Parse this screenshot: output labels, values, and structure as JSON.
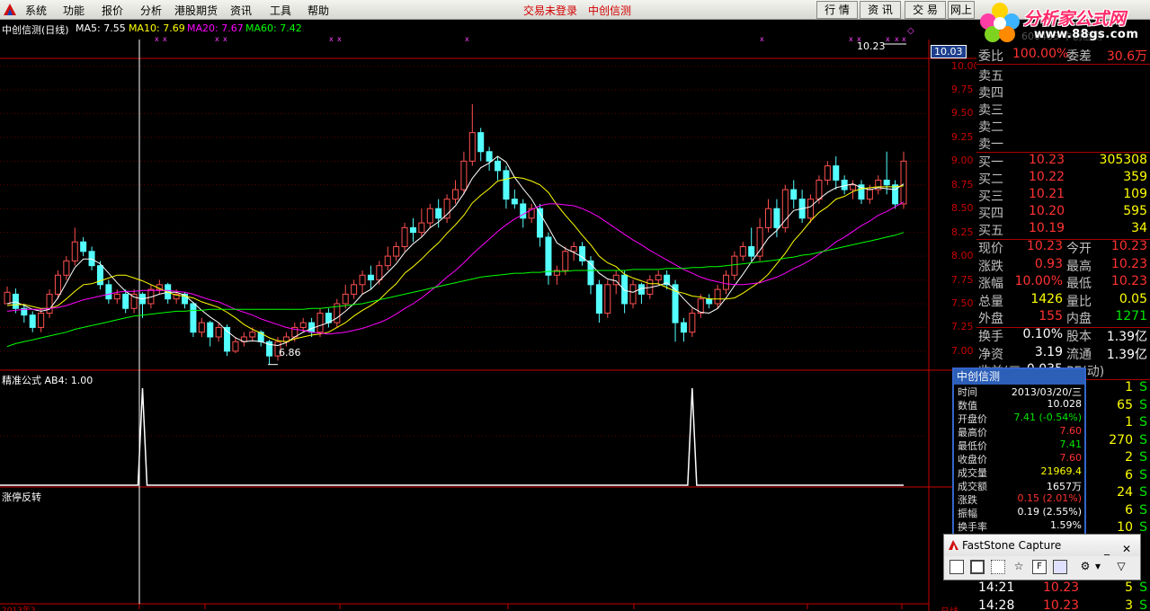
{
  "menu": {
    "items": [
      "系统",
      "功能",
      "报价",
      "分析",
      "港股期货",
      "资讯",
      "工具",
      "帮助"
    ],
    "status_text": "交易未登录",
    "stock_label": "中创信测",
    "right_tabs": [
      "行 情",
      "资 讯",
      "交 易",
      "网上"
    ]
  },
  "watermark": {
    "title": "分析家公式网",
    "url": "www.88gs.com",
    "ghost_text": "600485 中创信测"
  },
  "main_pane": {
    "title": "中创信测(日线)",
    "ma_labels": [
      {
        "text": "MA5: 7.55",
        "color": "#ffffff"
      },
      {
        "text": "MA10: 7.69",
        "color": "#ffff00"
      },
      {
        "text": "MA20: 7.67",
        "color": "#ff00ff"
      },
      {
        "text": "MA60: 7.42",
        "color": "#00ff00"
      }
    ],
    "price_axis": [
      "10.00",
      "9.75",
      "9.50",
      "9.25",
      "9.00",
      "8.75",
      "8.50",
      "8.25",
      "8.00",
      "7.75",
      "7.50",
      "7.25",
      "7.00"
    ],
    "current_price_tag": "10.03",
    "high_marker": "10.23",
    "low_marker": "6.86"
  },
  "indicator_pane": {
    "title": "精准公式 AB4: 1.00"
  },
  "bottom_pane": {
    "title": "涨停反转"
  },
  "bottom_axis": {
    "partial_date": "2013年3",
    "partial_right": "日线"
  },
  "panel": {
    "weibi": {
      "l1": "委比",
      "v1": "100.00%",
      "l2": "委差",
      "v2": "30.6万"
    },
    "sell": [
      "卖五",
      "卖四",
      "卖三",
      "卖二",
      "卖一"
    ],
    "buy": [
      {
        "label": "买一",
        "price": "10.23",
        "vol": "305308"
      },
      {
        "label": "买二",
        "price": "10.22",
        "vol": "359"
      },
      {
        "label": "买三",
        "price": "10.21",
        "vol": "109"
      },
      {
        "label": "买四",
        "price": "10.20",
        "vol": "595"
      },
      {
        "label": "买五",
        "price": "10.19",
        "vol": "34"
      }
    ],
    "stats": [
      {
        "l1": "现价",
        "v1": "10.23",
        "c1": "red",
        "l2": "今开",
        "v2": "10.23",
        "c2": "red"
      },
      {
        "l1": "涨跌",
        "v1": "0.93",
        "c1": "red",
        "l2": "最高",
        "v2": "10.23",
        "c2": "red"
      },
      {
        "l1": "涨幅",
        "v1": "10.00%",
        "c1": "red",
        "l2": "最低",
        "v2": "10.23",
        "c2": "red"
      },
      {
        "l1": "总量",
        "v1": "1426",
        "c1": "yel",
        "l2": "量比",
        "v2": "0.05",
        "c2": "yel"
      },
      {
        "l1": "外盘",
        "v1": "155",
        "c1": "red",
        "l2": "内盘",
        "v2": "1271",
        "c2": "green"
      }
    ],
    "stats2": [
      {
        "l1": "换手",
        "v1": "0.10%",
        "l2": "股本",
        "v2": "1.39亿"
      },
      {
        "l1": "净资",
        "v1": "3.19",
        "l2": "流通",
        "v2": "1.39亿"
      },
      {
        "l1": "收益(三",
        "v1": "0.035",
        "l2": "PE(动)",
        "v2": ""
      }
    ],
    "ticks": [
      {
        "vol": "1",
        "side": "S"
      },
      {
        "vol": "65",
        "side": "S"
      },
      {
        "vol": "1",
        "side": "S"
      },
      {
        "vol": "270",
        "side": "S"
      },
      {
        "vol": "2",
        "side": "S"
      },
      {
        "vol": "6",
        "side": "S"
      },
      {
        "vol": "24",
        "side": "S"
      },
      {
        "vol": "6",
        "side": "S"
      },
      {
        "vol": "10",
        "side": "S"
      }
    ],
    "bottom_ticks": [
      {
        "time": "14:21",
        "price": "10.23",
        "vol": "5",
        "side": "S"
      },
      {
        "time": "14:28",
        "price": "10.23",
        "vol": "3",
        "side": "S"
      }
    ]
  },
  "popup": {
    "title": "中创信测",
    "rows": [
      {
        "k": "时间",
        "v": "2013/03/20/三",
        "c": "#ffffff"
      },
      {
        "k": "数值",
        "v": "10.028",
        "c": "#ffffff"
      },
      {
        "k": "开盘价",
        "v": "7.41 (-0.54%)",
        "c": "#00e600"
      },
      {
        "k": "最高价",
        "v": "7.60",
        "c": "#ff3232"
      },
      {
        "k": "最低价",
        "v": "7.41",
        "c": "#00e600"
      },
      {
        "k": "收盘价",
        "v": "7.60",
        "c": "#ff3232"
      },
      {
        "k": "成交量",
        "v": "21969.4",
        "c": "#ffff00"
      },
      {
        "k": "成交额",
        "v": "1657万",
        "c": "#ffffff"
      },
      {
        "k": "涨跌",
        "v": "0.15 (2.01%)",
        "c": "#ff3232"
      },
      {
        "k": "振幅",
        "v": "0.19 (2.55%)",
        "c": "#ffffff"
      },
      {
        "k": "换手率",
        "v": "1.59%",
        "c": "#ffffff"
      }
    ]
  },
  "faststone": {
    "title": "FastStone Capture",
    "min_label": "_",
    "close_label": "✕"
  },
  "chart_data": {
    "type": "candlestick",
    "title": "中创信测(日线)",
    "ylim": [
      6.8,
      10.1
    ],
    "candles": [
      [
        7.5,
        7.62,
        7.55,
        7.68
      ],
      [
        7.6,
        7.45,
        7.4,
        7.66
      ],
      [
        7.45,
        7.38,
        7.3,
        7.5
      ],
      [
        7.38,
        7.25,
        7.2,
        7.42
      ],
      [
        7.25,
        7.4,
        7.2,
        7.45
      ],
      [
        7.4,
        7.6,
        7.35,
        7.65
      ],
      [
        7.6,
        7.8,
        7.55,
        7.85
      ],
      [
        7.8,
        7.95,
        7.75,
        8.0
      ],
      [
        7.95,
        8.15,
        7.9,
        8.3
      ],
      [
        8.15,
        8.05,
        8.0,
        8.2
      ],
      [
        8.05,
        7.9,
        7.85,
        8.1
      ],
      [
        7.9,
        7.7,
        7.65,
        7.95
      ],
      [
        7.7,
        7.55,
        7.5,
        7.75
      ],
      [
        7.55,
        7.6,
        7.5,
        7.65
      ],
      [
        7.6,
        7.45,
        7.4,
        7.65
      ],
      [
        7.45,
        7.6,
        7.4,
        7.65
      ],
      [
        7.6,
        7.5,
        7.35,
        7.62
      ],
      [
        7.5,
        7.65,
        7.45,
        7.7
      ],
      [
        7.65,
        7.7,
        7.6,
        7.75
      ],
      [
        7.7,
        7.55,
        7.5,
        7.72
      ],
      [
        7.55,
        7.6,
        7.5,
        7.65
      ],
      [
        7.6,
        7.5,
        7.45,
        7.62
      ],
      [
        7.5,
        7.2,
        7.15,
        7.52
      ],
      [
        7.2,
        7.3,
        7.15,
        7.35
      ],
      [
        7.3,
        7.15,
        7.05,
        7.32
      ],
      [
        7.15,
        7.25,
        7.1,
        7.3
      ],
      [
        7.25,
        7.0,
        6.95,
        7.28
      ],
      [
        7.0,
        7.1,
        6.98,
        7.15
      ],
      [
        7.1,
        7.15,
        7.05,
        7.2
      ],
      [
        7.15,
        7.2,
        7.1,
        7.25
      ],
      [
        7.2,
        7.1,
        7.05,
        7.22
      ],
      [
        7.1,
        6.95,
        6.86,
        7.12
      ],
      [
        6.95,
        7.1,
        6.9,
        7.15
      ],
      [
        7.1,
        7.15,
        7.05,
        7.2
      ],
      [
        7.15,
        7.25,
        7.1,
        7.3
      ],
      [
        7.25,
        7.3,
        7.2,
        7.35
      ],
      [
        7.3,
        7.2,
        7.15,
        7.35
      ],
      [
        7.2,
        7.4,
        7.15,
        7.45
      ],
      [
        7.4,
        7.3,
        7.25,
        7.45
      ],
      [
        7.3,
        7.5,
        7.25,
        7.55
      ],
      [
        7.5,
        7.6,
        7.45,
        7.7
      ],
      [
        7.6,
        7.7,
        7.55,
        7.75
      ],
      [
        7.7,
        7.8,
        7.6,
        7.85
      ],
      [
        7.8,
        7.75,
        7.65,
        7.9
      ],
      [
        7.75,
        7.9,
        7.7,
        7.95
      ],
      [
        7.9,
        8.0,
        7.85,
        8.1
      ],
      [
        8.0,
        8.1,
        7.95,
        8.15
      ],
      [
        8.1,
        8.3,
        8.05,
        8.35
      ],
      [
        8.3,
        8.25,
        8.15,
        8.4
      ],
      [
        8.25,
        8.35,
        8.2,
        8.5
      ],
      [
        8.35,
        8.5,
        8.3,
        8.55
      ],
      [
        8.5,
        8.4,
        8.3,
        8.6
      ],
      [
        8.4,
        8.6,
        8.35,
        8.65
      ],
      [
        8.6,
        8.7,
        8.55,
        8.8
      ],
      [
        8.7,
        9.0,
        8.65,
        9.1
      ],
      [
        9.0,
        9.3,
        8.95,
        9.6
      ],
      [
        9.3,
        9.1,
        9.0,
        9.35
      ],
      [
        9.1,
        9.0,
        8.9,
        9.15
      ],
      [
        9.0,
        8.9,
        8.8,
        9.05
      ],
      [
        8.9,
        8.6,
        8.5,
        8.95
      ],
      [
        8.6,
        8.55,
        8.5,
        8.7
      ],
      [
        8.55,
        8.4,
        8.3,
        8.6
      ],
      [
        8.4,
        8.5,
        8.35,
        8.55
      ],
      [
        8.5,
        8.2,
        8.1,
        8.55
      ],
      [
        8.2,
        7.8,
        7.7,
        8.25
      ],
      [
        7.8,
        7.85,
        7.7,
        7.9
      ],
      [
        7.85,
        8.05,
        7.8,
        8.1
      ],
      [
        8.05,
        8.1,
        7.95,
        8.15
      ],
      [
        8.1,
        7.95,
        7.9,
        8.15
      ],
      [
        7.95,
        7.7,
        7.6,
        8.0
      ],
      [
        7.7,
        7.4,
        7.3,
        7.75
      ],
      [
        7.4,
        7.7,
        7.35,
        7.75
      ],
      [
        7.7,
        7.8,
        7.6,
        7.85
      ],
      [
        7.8,
        7.5,
        7.4,
        7.85
      ],
      [
        7.5,
        7.7,
        7.45,
        7.75
      ],
      [
        7.7,
        7.6,
        7.5,
        7.72
      ],
      [
        7.6,
        7.75,
        7.55,
        7.8
      ],
      [
        7.75,
        7.8,
        7.7,
        7.85
      ],
      [
        7.8,
        7.7,
        7.65,
        7.85
      ],
      [
        7.7,
        7.3,
        7.1,
        7.75
      ],
      [
        7.3,
        7.2,
        7.1,
        7.35
      ],
      [
        7.2,
        7.4,
        7.15,
        7.45
      ],
      [
        7.4,
        7.55,
        7.35,
        7.6
      ],
      [
        7.55,
        7.5,
        7.45,
        7.6
      ],
      [
        7.5,
        7.65,
        7.45,
        7.7
      ],
      [
        7.65,
        7.8,
        7.6,
        7.85
      ],
      [
        7.8,
        8.0,
        7.75,
        8.05
      ],
      [
        8.0,
        8.1,
        7.95,
        8.15
      ],
      [
        8.1,
        8.0,
        7.95,
        8.3
      ],
      [
        8.0,
        8.3,
        7.95,
        8.4
      ],
      [
        8.3,
        8.5,
        8.25,
        8.6
      ],
      [
        8.5,
        8.3,
        8.2,
        8.6
      ],
      [
        8.3,
        8.7,
        8.25,
        8.75
      ],
      [
        8.7,
        8.6,
        8.5,
        8.8
      ],
      [
        8.6,
        8.4,
        8.35,
        8.7
      ],
      [
        8.4,
        8.6,
        8.35,
        8.65
      ],
      [
        8.6,
        8.8,
        8.55,
        8.85
      ],
      [
        8.8,
        8.95,
        8.75,
        9.0
      ],
      [
        8.95,
        8.8,
        8.7,
        9.05
      ],
      [
        8.8,
        8.7,
        8.65,
        8.85
      ],
      [
        8.7,
        8.75,
        8.6,
        8.8
      ],
      [
        8.75,
        8.6,
        8.55,
        8.8
      ],
      [
        8.6,
        8.7,
        8.55,
        8.75
      ],
      [
        8.7,
        8.8,
        8.65,
        8.85
      ],
      [
        8.8,
        8.75,
        8.65,
        9.1
      ],
      [
        8.75,
        8.55,
        8.5,
        8.8
      ],
      [
        8.55,
        9.0,
        8.5,
        9.1
      ]
    ],
    "ma_series": [
      {
        "name": "MA5",
        "color": "#ffffff",
        "values": [
          7.5,
          7.52,
          7.48,
          7.44,
          7.42,
          7.44,
          7.56,
          7.72,
          7.88,
          7.97,
          7.97,
          7.92,
          7.82,
          7.72,
          7.63,
          7.57,
          7.55,
          7.57,
          7.6,
          7.62,
          7.62,
          7.59,
          7.51,
          7.43,
          7.36,
          7.3,
          7.21,
          7.14,
          7.1,
          7.11,
          7.1,
          7.07,
          7.06,
          7.09,
          7.15,
          7.2,
          7.24,
          7.27,
          7.3,
          7.35,
          7.42,
          7.5,
          7.6,
          7.65,
          7.74,
          7.83,
          7.92,
          8.04,
          8.13,
          8.2,
          8.3,
          8.36,
          8.44,
          8.53,
          8.66,
          8.82,
          8.93,
          8.98,
          9.05,
          8.99,
          8.83,
          8.71,
          8.6,
          8.45,
          8.3,
          8.14,
          8.08,
          8.04,
          7.99,
          7.92,
          7.82,
          7.76,
          7.74,
          7.64,
          7.62,
          7.66,
          7.67,
          7.69,
          7.72,
          7.65,
          7.55,
          7.46,
          7.41,
          7.4,
          7.45,
          7.56,
          7.69,
          7.81,
          7.94,
          8.06,
          8.19,
          8.27,
          8.38,
          8.48,
          8.5,
          8.52,
          8.6,
          8.67,
          8.72,
          8.74,
          8.76,
          8.72,
          8.7,
          8.72,
          8.71,
          8.7,
          8.76
        ]
      },
      {
        "name": "MA10",
        "color": "#ffff00",
        "values": [
          7.48,
          7.49,
          7.49,
          7.47,
          7.45,
          7.45,
          7.48,
          7.55,
          7.63,
          7.7,
          7.71,
          7.74,
          7.77,
          7.8,
          7.8,
          7.77,
          7.74,
          7.7,
          7.66,
          7.62,
          7.59,
          7.58,
          7.56,
          7.52,
          7.49,
          7.46,
          7.41,
          7.35,
          7.28,
          7.23,
          7.19,
          7.14,
          7.11,
          7.1,
          7.13,
          7.15,
          7.17,
          7.18,
          7.2,
          7.25,
          7.3,
          7.37,
          7.43,
          7.48,
          7.54,
          7.63,
          7.71,
          7.82,
          7.89,
          7.97,
          8.06,
          8.14,
          8.24,
          8.33,
          8.43,
          8.56,
          8.64,
          8.71,
          8.79,
          8.81,
          8.83,
          8.82,
          8.79,
          8.75,
          8.67,
          8.54,
          8.43,
          8.33,
          8.22,
          8.12,
          8.0,
          7.93,
          7.89,
          7.81,
          7.77,
          7.74,
          7.71,
          7.71,
          7.67,
          7.63,
          7.61,
          7.58,
          7.57,
          7.55,
          7.55,
          7.55,
          7.56,
          7.61,
          7.67,
          7.73,
          7.81,
          7.92,
          8.03,
          8.16,
          8.26,
          8.37,
          8.46,
          8.52,
          8.6,
          8.63,
          8.68,
          8.71,
          8.72,
          8.73,
          8.73,
          8.73,
          8.74
        ]
      },
      {
        "name": "MA20",
        "color": "#ff00ff",
        "values": [
          7.42,
          7.43,
          7.44,
          7.44,
          7.44,
          7.45,
          7.46,
          7.48,
          7.51,
          7.54,
          7.56,
          7.58,
          7.6,
          7.62,
          7.63,
          7.63,
          7.64,
          7.64,
          7.64,
          7.64,
          7.63,
          7.62,
          7.6,
          7.57,
          7.54,
          7.52,
          7.48,
          7.44,
          7.41,
          7.38,
          7.34,
          7.31,
          7.28,
          7.25,
          7.23,
          7.22,
          7.2,
          7.19,
          7.18,
          7.19,
          7.2,
          7.22,
          7.24,
          7.27,
          7.3,
          7.34,
          7.39,
          7.45,
          7.5,
          7.56,
          7.63,
          7.7,
          7.78,
          7.85,
          7.93,
          8.02,
          8.1,
          8.18,
          8.26,
          8.33,
          8.39,
          8.44,
          8.49,
          8.53,
          8.55,
          8.55,
          8.54,
          8.53,
          8.5,
          8.46,
          8.41,
          8.35,
          8.29,
          8.23,
          8.17,
          8.12,
          8.06,
          8.01,
          7.96,
          7.91,
          7.86,
          7.82,
          7.78,
          7.75,
          7.73,
          7.71,
          7.7,
          7.7,
          7.71,
          7.72,
          7.75,
          7.78,
          7.82,
          7.87,
          7.91,
          7.96,
          8.02,
          8.08,
          8.15,
          8.2,
          8.26,
          8.32,
          8.37,
          8.43,
          8.47,
          8.52,
          8.57
        ]
      },
      {
        "name": "MA60",
        "color": "#00ff00",
        "values": [
          7.05,
          7.08,
          7.1,
          7.12,
          7.14,
          7.16,
          7.18,
          7.2,
          7.23,
          7.25,
          7.27,
          7.29,
          7.31,
          7.33,
          7.35,
          7.37,
          7.38,
          7.39,
          7.4,
          7.41,
          7.42,
          7.42,
          7.43,
          7.43,
          7.44,
          7.44,
          7.44,
          7.44,
          7.44,
          7.44,
          7.44,
          7.44,
          7.44,
          7.44,
          7.44,
          7.44,
          7.45,
          7.45,
          7.46,
          7.47,
          7.48,
          7.49,
          7.5,
          7.52,
          7.54,
          7.56,
          7.58,
          7.6,
          7.62,
          7.64,
          7.66,
          7.68,
          7.7,
          7.72,
          7.74,
          7.76,
          7.78,
          7.79,
          7.8,
          7.81,
          7.82,
          7.82,
          7.83,
          7.83,
          7.84,
          7.84,
          7.84,
          7.85,
          7.85,
          7.85,
          7.85,
          7.85,
          7.85,
          7.85,
          7.86,
          7.86,
          7.86,
          7.86,
          7.87,
          7.87,
          7.87,
          7.88,
          7.88,
          7.89,
          7.89,
          7.9,
          7.91,
          7.92,
          7.93,
          7.94,
          7.95,
          7.96,
          7.98,
          7.99,
          8.01,
          8.02,
          8.04,
          8.06,
          8.08,
          8.1,
          8.12,
          8.14,
          8.16,
          8.18,
          8.2,
          8.22,
          8.25
        ]
      }
    ],
    "signal_indices": [
      16,
      81
    ]
  }
}
